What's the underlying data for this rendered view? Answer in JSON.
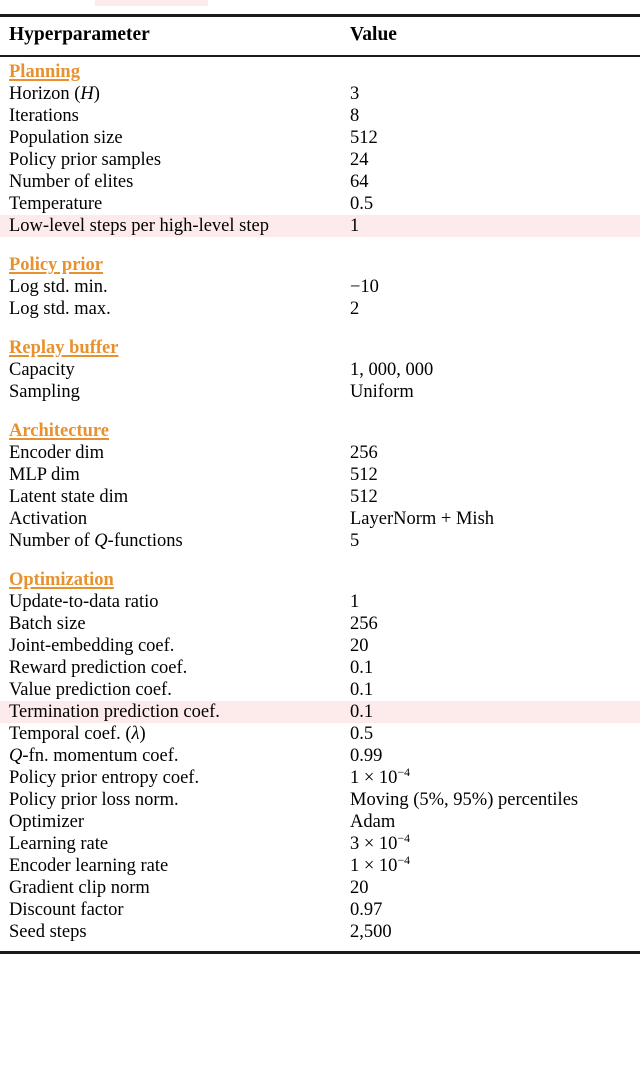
{
  "table": {
    "columns": [
      "Hyperparameter",
      "Value"
    ],
    "top_highlight_fragment": true,
    "highlight_color": "#fdeaea",
    "section_color": "#e8912f",
    "sections": [
      {
        "title": "Planning",
        "rows": [
          {
            "key": "Horizon (H)",
            "key_html": "Horizon (<span class=\"mathit\">H</span>)",
            "value": "3",
            "highlight": false
          },
          {
            "key": "Iterations",
            "value": "8",
            "highlight": false
          },
          {
            "key": "Population size",
            "value": "512",
            "highlight": false
          },
          {
            "key": "Policy prior samples",
            "value": "24",
            "highlight": false
          },
          {
            "key": "Number of elites",
            "value": "64",
            "highlight": false
          },
          {
            "key": "Temperature",
            "value": "0.5",
            "highlight": false
          },
          {
            "key": "Low-level steps per high-level step",
            "value": "1",
            "highlight": true
          }
        ]
      },
      {
        "title": "Policy prior",
        "rows": [
          {
            "key": "Log std. min.",
            "value": "−10",
            "highlight": false
          },
          {
            "key": "Log std. max.",
            "value": "2",
            "highlight": false
          }
        ]
      },
      {
        "title": "Replay buffer",
        "rows": [
          {
            "key": "Capacity",
            "value": "1, 000, 000",
            "highlight": false
          },
          {
            "key": "Sampling",
            "value": "Uniform",
            "highlight": false
          }
        ]
      },
      {
        "title": "Architecture",
        "rows": [
          {
            "key": "Encoder dim",
            "value": "256",
            "highlight": false
          },
          {
            "key": "MLP dim",
            "value": "512",
            "highlight": false
          },
          {
            "key": "Latent state dim",
            "value": "512",
            "highlight": false
          },
          {
            "key": "Activation",
            "value": "LayerNorm + Mish",
            "highlight": false
          },
          {
            "key": "Number of Q-functions",
            "key_html": "Number of <span class=\"mathit\">Q</span>-functions",
            "value": "5",
            "highlight": false
          }
        ]
      },
      {
        "title": "Optimization",
        "rows": [
          {
            "key": "Update-to-data ratio",
            "value": "1",
            "highlight": false
          },
          {
            "key": "Batch size",
            "value": "256",
            "highlight": false
          },
          {
            "key": "Joint-embedding coef.",
            "value": "20",
            "highlight": false
          },
          {
            "key": "Reward prediction coef.",
            "value": "0.1",
            "highlight": false
          },
          {
            "key": "Value prediction coef.",
            "value": "0.1",
            "highlight": false
          },
          {
            "key": "Termination prediction coef.",
            "value": "0.1",
            "highlight": true
          },
          {
            "key": "Temporal coef. (λ)",
            "key_html": "Temporal coef. (<span class=\"mathit\">λ</span>)",
            "value": "0.5",
            "highlight": false
          },
          {
            "key": "Q-fn. momentum coef.",
            "key_html": "<span class=\"mathit\">Q</span>-fn. momentum coef.",
            "value": "0.99",
            "highlight": false
          },
          {
            "key": "Policy prior entropy coef.",
            "value": "1 × 10⁻⁴",
            "value_html": "1 × 10<sup>−4</sup>",
            "highlight": false
          },
          {
            "key": "Policy prior loss norm.",
            "value": "Moving (5%, 95%) percentiles",
            "highlight": false
          },
          {
            "key": "Optimizer",
            "value": "Adam",
            "highlight": false
          },
          {
            "key": "Learning rate",
            "value": "3 × 10⁻⁴",
            "value_html": "3 × 10<sup>−4</sup>",
            "highlight": false
          },
          {
            "key": "Encoder learning rate",
            "value": "1 × 10⁻⁴",
            "value_html": "1 × 10<sup>−4</sup>",
            "highlight": false
          },
          {
            "key": "Gradient clip norm",
            "value": "20",
            "highlight": false
          },
          {
            "key": "Discount factor",
            "value": "0.97",
            "highlight": false
          },
          {
            "key": "Seed steps",
            "value": "2,500",
            "highlight": false
          }
        ]
      }
    ]
  }
}
